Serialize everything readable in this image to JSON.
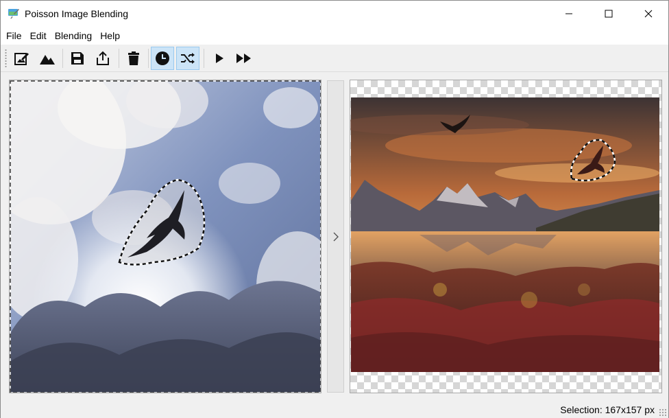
{
  "window": {
    "title": "Poisson Image Blending",
    "app_icon": "paintbrush-app-icon",
    "controls": [
      "minimize-icon",
      "maximize-icon",
      "close-icon"
    ]
  },
  "menu": {
    "items": [
      {
        "label": "File"
      },
      {
        "label": "Edit"
      },
      {
        "label": "Blending"
      },
      {
        "label": "Help"
      }
    ]
  },
  "toolbar": {
    "buttons": [
      {
        "icon": "edit-image-icon",
        "active": false
      },
      {
        "icon": "landscape-icon",
        "active": false
      },
      {
        "icon": "save-icon",
        "active": false
      },
      {
        "icon": "export-icon",
        "active": false
      },
      {
        "icon": "trash-icon",
        "active": false
      },
      {
        "icon": "clock-icon",
        "active": true
      },
      {
        "icon": "shuffle-icon",
        "active": true
      },
      {
        "icon": "play-icon",
        "active": false
      },
      {
        "icon": "fast-forward-icon",
        "active": false
      }
    ]
  },
  "source_panel": {
    "content": "cloud-sky-photo",
    "selection": "bird-silhouette-lasso"
  },
  "target_panel": {
    "content": "mountain-lake-sunset-photo",
    "selection": "bird-blended-lasso"
  },
  "splitter": {
    "icon": "chevron-right-icon"
  },
  "status": {
    "selection_text": "Selection: 167x157 px"
  },
  "colors": {
    "active_button": "#cce4f7",
    "window_bg": "#f0f0f0",
    "sky_blue": "#7d8fb8",
    "sunset_orange": "#e09a52",
    "foliage_red": "#8e2a2a"
  }
}
